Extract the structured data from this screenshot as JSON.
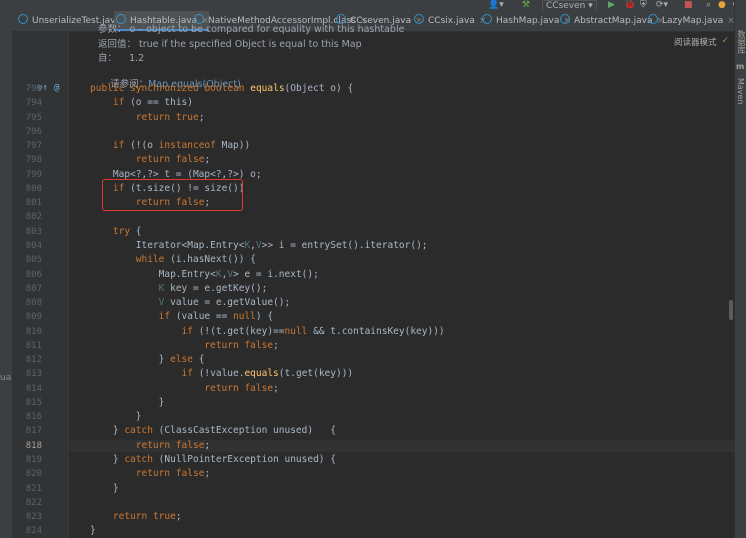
{
  "toolbar": {
    "run_config": "CCseven",
    "run_config_arrow": "▾",
    "icons": [
      "user-icon",
      "hammer-icon",
      "run-icon",
      "debug-icon",
      "coverage-icon",
      "profile-icon",
      "stop-icon",
      "search-icon",
      "update-icon",
      "settings-icon"
    ]
  },
  "tabs": [
    {
      "label": "UnserializeTest.java",
      "active": false
    },
    {
      "label": "Hashtable.java",
      "active": true
    },
    {
      "label": "NativeMethodAccessorImpl.class",
      "active": false
    },
    {
      "label": "CCseven.java",
      "active": false
    },
    {
      "label": "CCsix.java",
      "active": false
    },
    {
      "label": "HashMap.java",
      "active": false
    },
    {
      "label": "AbstractMap.java",
      "active": false
    },
    {
      "label": "LazyMap.java",
      "active": false
    }
  ],
  "tab_close": "×",
  "editor": {
    "reader_mode": "阅读器模式",
    "check": "✓",
    "doc_lines": [
      {
        "text": "参数： o – object to be compared for equality with this hashtable"
      },
      {
        "text": "返回值： true if the specified Object is equal to this Map"
      },
      {
        "text": "自：    1.2"
      },
      {
        "label": "请参阅：",
        "link": "Map.equals(Object)"
      }
    ],
    "lines": [
      {
        "n": "793",
        "code": "public synchronized boolean equals(Object o) {"
      },
      {
        "n": "794",
        "code": "    if (o == this)"
      },
      {
        "n": "795",
        "code": "        return true;"
      },
      {
        "n": "796",
        "code": ""
      },
      {
        "n": "797",
        "code": "    if (!(o instanceof Map))"
      },
      {
        "n": "798",
        "code": "        return false;"
      },
      {
        "n": "799",
        "code": "    Map<?,?> t = (Map<?,?>) o;"
      },
      {
        "n": "800",
        "code": "    if (t.size() != size())"
      },
      {
        "n": "801",
        "code": "        return false;"
      },
      {
        "n": "802",
        "code": ""
      },
      {
        "n": "803",
        "code": "    try {"
      },
      {
        "n": "804",
        "code": "        Iterator<Map.Entry<K,V>> i = entrySet().iterator();"
      },
      {
        "n": "805",
        "code": "        while (i.hasNext()) {"
      },
      {
        "n": "806",
        "code": "            Map.Entry<K,V> e = i.next();"
      },
      {
        "n": "807",
        "code": "            K key = e.getKey();"
      },
      {
        "n": "808",
        "code": "            V value = e.getValue();"
      },
      {
        "n": "809",
        "code": "            if (value == null) {"
      },
      {
        "n": "810",
        "code": "                if (!(t.get(key)==null && t.containsKey(key)))"
      },
      {
        "n": "811",
        "code": "                    return false;"
      },
      {
        "n": "812",
        "code": "            } else {"
      },
      {
        "n": "813",
        "code": "                if (!value.equals(t.get(key)))"
      },
      {
        "n": "814",
        "code": "                    return false;"
      },
      {
        "n": "815",
        "code": "            }"
      },
      {
        "n": "816",
        "code": "        }"
      },
      {
        "n": "817",
        "code": "    } catch (ClassCastException unused)   {"
      },
      {
        "n": "818",
        "code": "        return false;"
      },
      {
        "n": "819",
        "code": "    } catch (NullPointerException unused) {"
      },
      {
        "n": "820",
        "code": "        return false;"
      },
      {
        "n": "821",
        "code": "    }"
      },
      {
        "n": "822",
        "code": ""
      },
      {
        "n": "823",
        "code": "    return true;"
      },
      {
        "n": "824",
        "code": "}"
      }
    ],
    "current_line": "818"
  },
  "left_panel": {
    "label": "ual"
  },
  "right_panel": {
    "labels": [
      "数据库",
      "m",
      "Maven"
    ]
  },
  "colors": {
    "keyword": "#cc7832",
    "method": "#ffc66d",
    "highlight_box": "#e0372e",
    "active_tab": "#4a88c7"
  }
}
